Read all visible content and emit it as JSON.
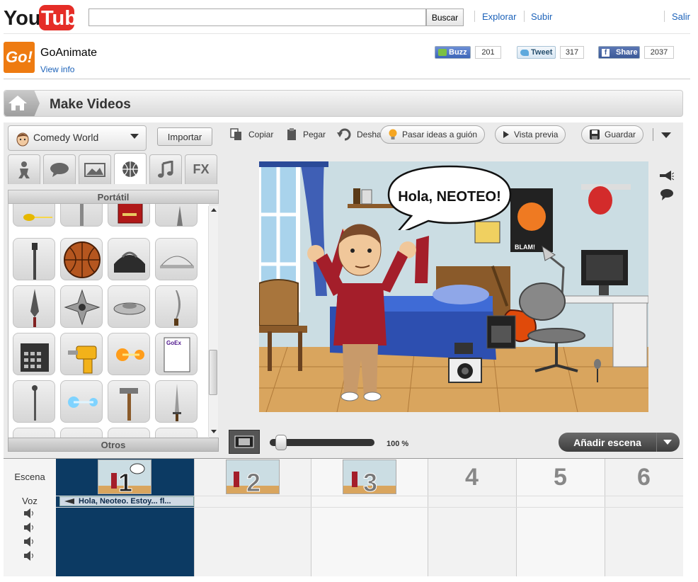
{
  "youtube": {
    "logo": "YouTube",
    "search_placeholder": "",
    "search_button": "Buscar",
    "links": [
      "Explorar",
      "Subir"
    ],
    "signout": "Salir"
  },
  "channel": {
    "logo_text": "Go!",
    "name": "GoAnimate",
    "view_info": "View info",
    "buzz": {
      "label": "Buzz",
      "count": "201"
    },
    "tweet": {
      "label": "Tweet",
      "count": "317"
    },
    "share": {
      "label": "Share",
      "count": "2037"
    }
  },
  "page": {
    "title": "Make Videos"
  },
  "library": {
    "world": "Comedy World",
    "import": "Importar",
    "tabs": [
      "character",
      "speech",
      "background",
      "prop",
      "music",
      "FX"
    ],
    "category": "Portátil",
    "footer_category": "Otros"
  },
  "toolbar": {
    "copy": "Copiar",
    "paste": "Pegar",
    "undo": "Desha",
    "ideas": "Pasar ideas a guión",
    "preview": "Vista previa",
    "save": "Guardar"
  },
  "stage": {
    "speech_text": "Hola, NEOTEO!",
    "poster_text": "BLAM!"
  },
  "zoom": {
    "value": "100 %"
  },
  "add_scene": "Añadir escena",
  "timeline": {
    "row_labels": {
      "scene": "Escena",
      "voice": "Voz"
    },
    "scenes": [
      "1",
      "2",
      "3",
      "4",
      "5",
      "6"
    ],
    "voice_clip": "Hola, Neoteo. Estoy... fl..."
  },
  "colors": {
    "youtube_red": "#e52d27",
    "go_orange": "#ee7b11",
    "link_blue": "#1c62b9",
    "timeline_selected": "#0c3a63",
    "buzz_blue": "#3b65b8",
    "tweet_blue": "#5ea9dd",
    "facebook_blue": "#3b5998"
  }
}
